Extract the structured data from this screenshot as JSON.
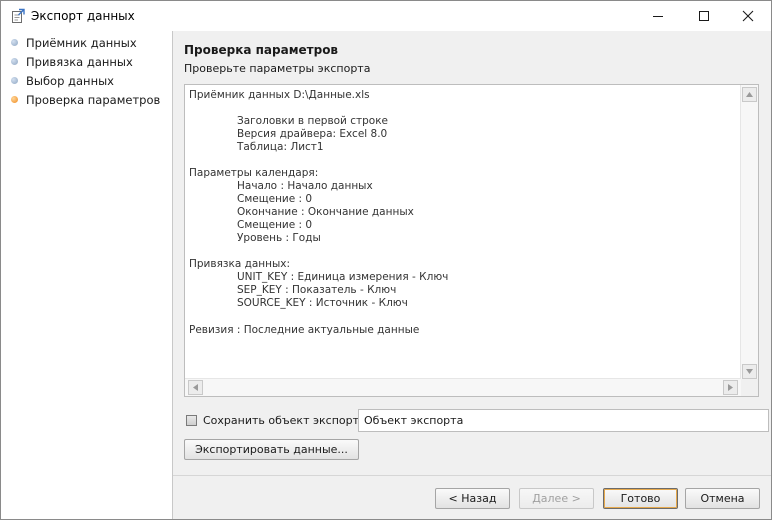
{
  "window": {
    "title": "Экспорт данных"
  },
  "steps": [
    {
      "label": "Приёмник данных",
      "active": false
    },
    {
      "label": "Привязка данных",
      "active": false
    },
    {
      "label": "Выбор данных",
      "active": false
    },
    {
      "label": "Проверка параметров",
      "active": true
    }
  ],
  "panel": {
    "title": "Проверка параметров",
    "subtitle": "Проверьте параметры экспорта"
  },
  "summary": {
    "receiver": "Приёмник данных D:\\Данные.xls",
    "headers": "Заголовки в первой строке",
    "driver": "Версия драйвера: Excel 8.0",
    "table": "Таблица: Лист1",
    "calendar_header": "Параметры календаря:",
    "cal_start": "Начало : Начало данных",
    "cal_offset1": "Смещение : 0",
    "cal_end": "Окончание : Окончание данных",
    "cal_offset2": "Смещение : 0",
    "cal_level": "Уровень : Годы",
    "binding_header": "Привязка данных:",
    "bind_unit": "UNIT_KEY : Единица измерения - Ключ",
    "bind_sep": "SEP_KEY : Показатель - Ключ",
    "bind_source": "SOURCE_KEY : Источник - Ключ",
    "revision": "Ревизия : Последние актуальные данные"
  },
  "save_object": {
    "label": "Сохранить объект экспорта:",
    "value": "Объект экспорта",
    "checked": false
  },
  "buttons": {
    "export": "Экспортировать данные...",
    "back": "< Назад",
    "next": "Далее >",
    "finish": "Готово",
    "cancel": "Отмена"
  },
  "colors": {
    "active_step": "#ef8a1f",
    "inactive_step": "#8fa6c2",
    "default_button_accent": "#e6a94d"
  }
}
